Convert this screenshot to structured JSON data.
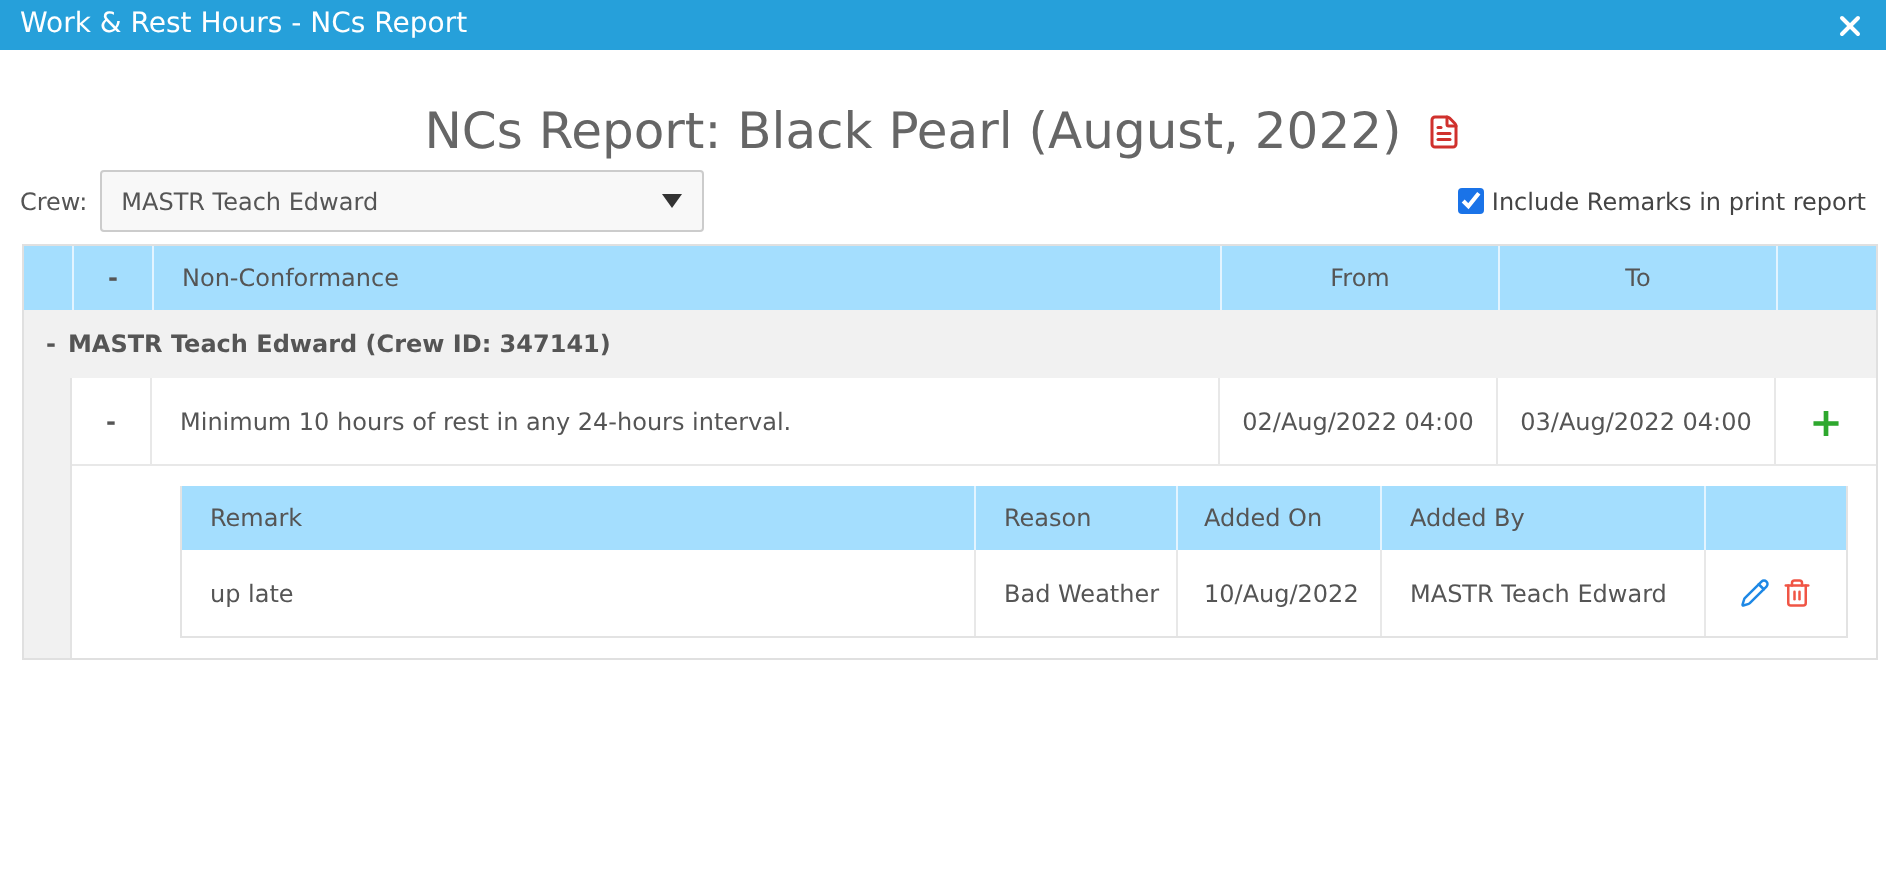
{
  "window": {
    "title": "Work & Rest Hours - NCs Report"
  },
  "heading": "NCs Report: Black Pearl (August, 2022)",
  "crew": {
    "label": "Crew:",
    "value": "MASTR Teach Edward"
  },
  "include_remarks": {
    "label": "Include Remarks in print report",
    "checked": true
  },
  "table": {
    "columns": [
      "-",
      "Non-Conformance",
      "From",
      "To"
    ],
    "groups": [
      {
        "toggle": "-",
        "label": "MASTR Teach Edward (Crew ID: 347141)",
        "expanded": true,
        "items": [
          {
            "toggle": "-",
            "description": "Minimum 10 hours of rest in any 24-hours interval.",
            "from": "02/Aug/2022 04:00",
            "to": "03/Aug/2022 04:00",
            "add": "+",
            "expanded": true,
            "remarks": {
              "columns": [
                "Remark",
                "Reason",
                "Added On",
                "Added By"
              ],
              "rows": [
                {
                  "remark": "up late",
                  "reason": "Bad Weather",
                  "added_on": "10/Aug/2022",
                  "added_by": "MASTR Teach Edward"
                }
              ]
            }
          }
        ]
      }
    ]
  }
}
